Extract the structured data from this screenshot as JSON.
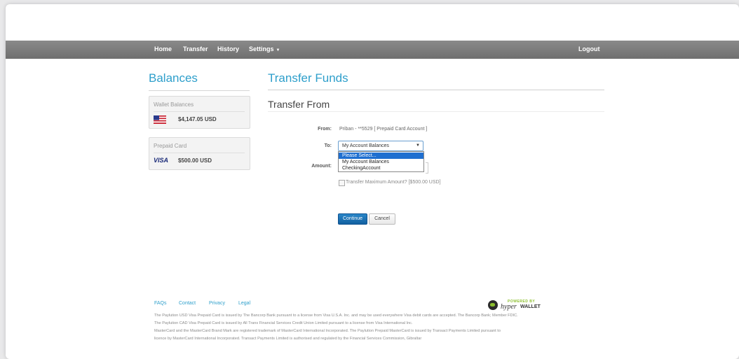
{
  "nav": {
    "home": "Home",
    "transfer": "Transfer",
    "history": "History",
    "settings": "Settings",
    "settings_caret": "▼",
    "logout": "Logout"
  },
  "sidebar": {
    "title": "Balances",
    "wallet": {
      "title": "Wallet Balances",
      "amount": "$4,147.05 USD",
      "icon": "us-flag-icon"
    },
    "prepaid": {
      "title": "Prepaid Card",
      "amount": "$500.00 USD",
      "logo": "VISA"
    }
  },
  "main": {
    "title": "Transfer Funds",
    "section_title": "Transfer From",
    "from_label": "From:",
    "from_value": "Priban - **5529 [ Prepaid Card Account ]",
    "to_label": "To:",
    "to_selected": "My Account Balances",
    "to_arrow": "▼",
    "to_options": [
      "Please Select...",
      "My Account Balances",
      "CheckingAccount"
    ],
    "amount_label": "Amount:",
    "max_label": "Transfer Maximum Amount? [$500.00 USD]",
    "continue_label": "Continue",
    "cancel_label": "Cancel"
  },
  "footer": {
    "links": [
      "FAQs",
      "Contact",
      "Privacy",
      "Legal"
    ],
    "logo_powered": "POWERED BY",
    "logo_hyper": "hyper",
    "logo_wallet": "WALLET",
    "lines": [
      "The Paylution USD Visa Prepaid Card is issued by The Bancorp Bank pursuant to a license from Visa U.S.A. Inc. and may be used everywhere Visa debit cards are accepted. The Bancorp Bank; Member FDIC.",
      "The Paylution CAD Visa Prepaid Card is issued by All Trans Financial Services Credit Union Limited pursuant to a license from Visa International Inc.",
      "MasterCard and the MasterCard Brand Mark are registered trademark of MasterCard International Incorporated. The Paylution Prepaid MasterCard is issued by Transact Payments Limited pursuant to",
      "licence by MasterCard International Incorporated. Transact Payments Limited is authorised and regulated by the Financial Services Commission, Gibraltar"
    ]
  },
  "colors": {
    "accent": "#2e9fcb",
    "navbar": "#7a7a7a",
    "primary_button": "#1a6fb3",
    "selected_option": "#1f6fd0"
  }
}
